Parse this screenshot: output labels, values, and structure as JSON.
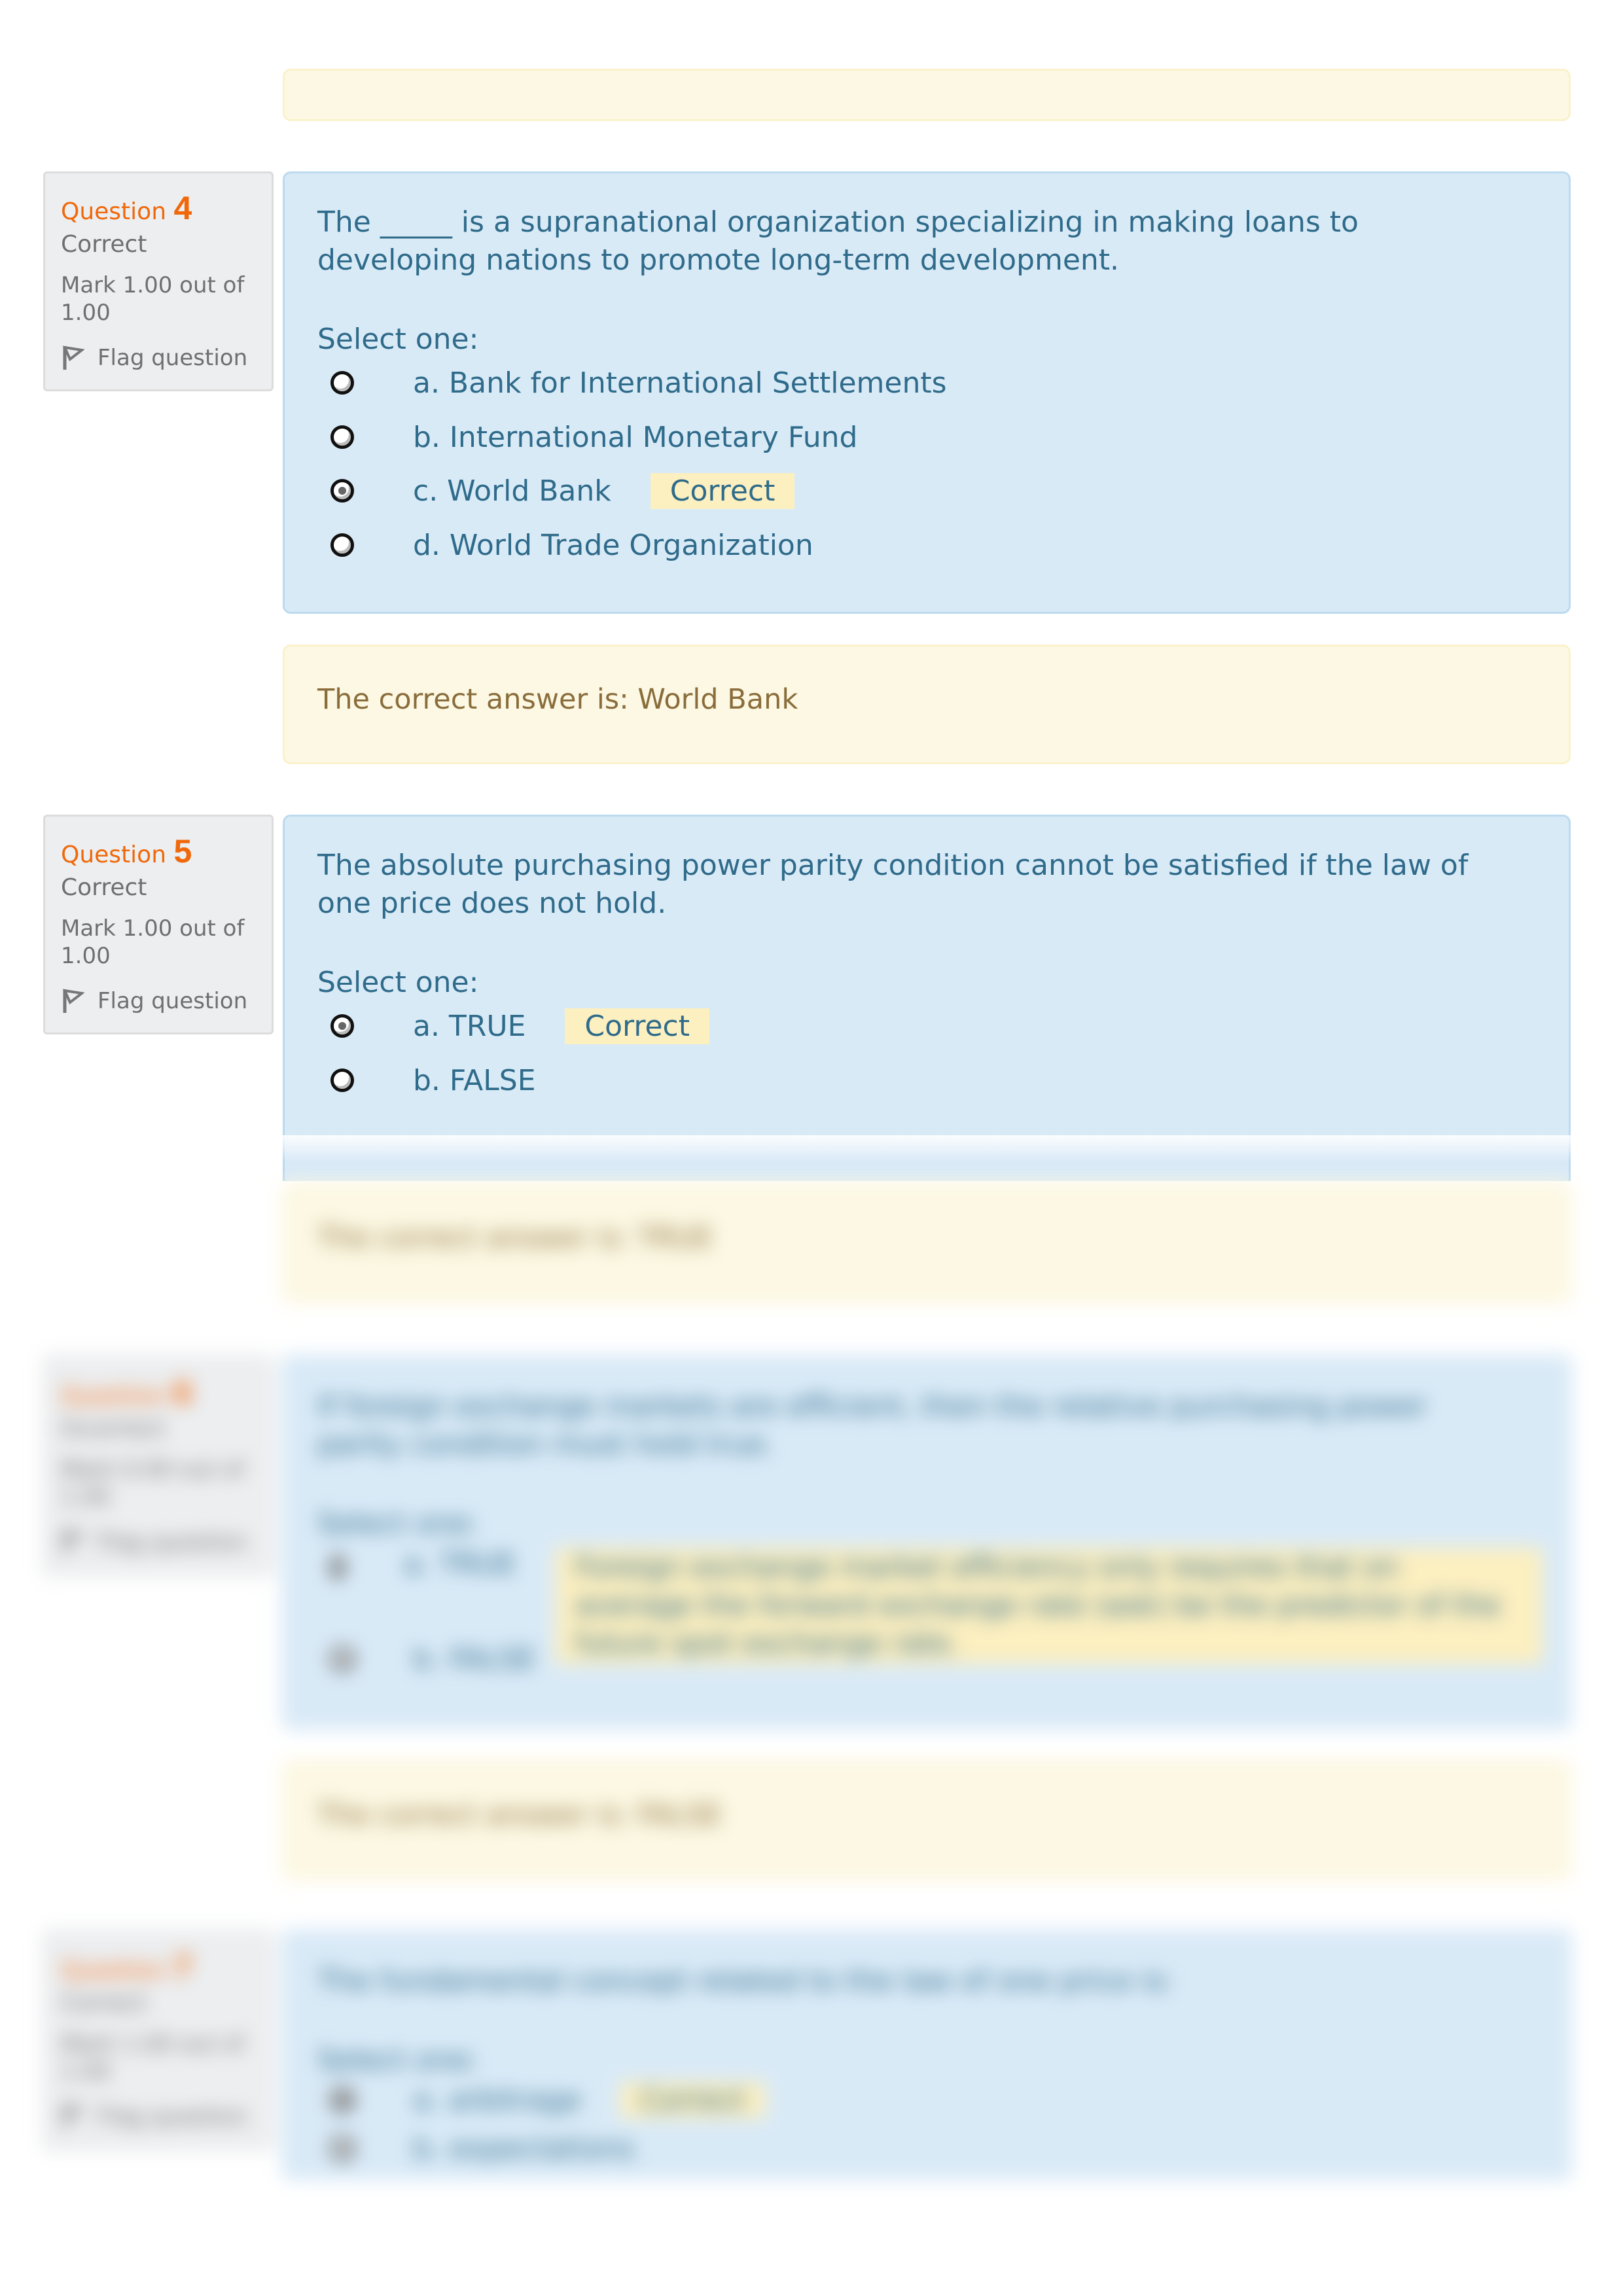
{
  "top_feedback": {
    "text": ""
  },
  "questions": [
    {
      "label": "Question",
      "number": "4",
      "state": "Correct",
      "grade": "Mark 1.00 out of 1.00",
      "flag_label": "Flag question",
      "text": "The _____ is a supranational organization specializing in making loans to developing nations to promote long-term development.",
      "select_prompt": "Select one:",
      "options": [
        {
          "label": "a. Bank for International Settlements",
          "checked": false,
          "feedback": ""
        },
        {
          "label": "b. International Monetary Fund",
          "checked": false,
          "feedback": ""
        },
        {
          "label": "c. World Bank",
          "checked": true,
          "feedback": "Correct"
        },
        {
          "label": "d. World Trade Organization",
          "checked": false,
          "feedback": ""
        }
      ],
      "right_answer": "The correct answer is: World Bank"
    },
    {
      "label": "Question",
      "number": "5",
      "state": "Correct",
      "grade": "Mark 1.00 out of 1.00",
      "flag_label": "Flag question",
      "text": "The absolute purchasing power parity condition cannot be satisfied if the law of one price does not hold.",
      "select_prompt": "Select one:",
      "options": [
        {
          "label": "a. TRUE",
          "checked": true,
          "feedback": "Correct"
        },
        {
          "label": "b. FALSE",
          "checked": false,
          "feedback": ""
        }
      ],
      "right_answer": "The correct answer is: TRUE"
    },
    {
      "label": "Question",
      "number": "6",
      "state": "Incorrect",
      "grade": "Mark 0.00 out of 1.00",
      "flag_label": "Flag question",
      "text": "If foreign exchange markets are efficient, then the relative purchasing power parity condition must hold true.",
      "select_prompt": "Select one:",
      "options": [
        {
          "label": "a. TRUE",
          "checked": true,
          "feedback": "Foreign exchange market efficiency only requires that on average the forward exchange rate (ask) be the predictor of the future spot exchange rate."
        },
        {
          "label": "b. FALSE",
          "checked": false,
          "feedback": ""
        }
      ],
      "right_answer": "The correct answer is: FALSE"
    },
    {
      "label": "Question",
      "number": "7",
      "state": "Correct",
      "grade": "Mark 1.00 out of 1.00",
      "flag_label": "Flag question",
      "text": "The fundamental concept related to the law of one price is:",
      "select_prompt": "Select one:",
      "options": [
        {
          "label": "a. arbitrage",
          "checked": true,
          "feedback": "Correct"
        },
        {
          "label": "b. expectations",
          "checked": false,
          "feedback": ""
        }
      ],
      "right_answer": ""
    }
  ],
  "colors": {
    "question_label": "#f0680a",
    "question_text": "#2f6b8a",
    "feedback_bg": "#fcefc0",
    "info_bg": "#fcf8e3",
    "question_bg": "#d9eaf7",
    "sidebar_bg": "#eceef0"
  }
}
